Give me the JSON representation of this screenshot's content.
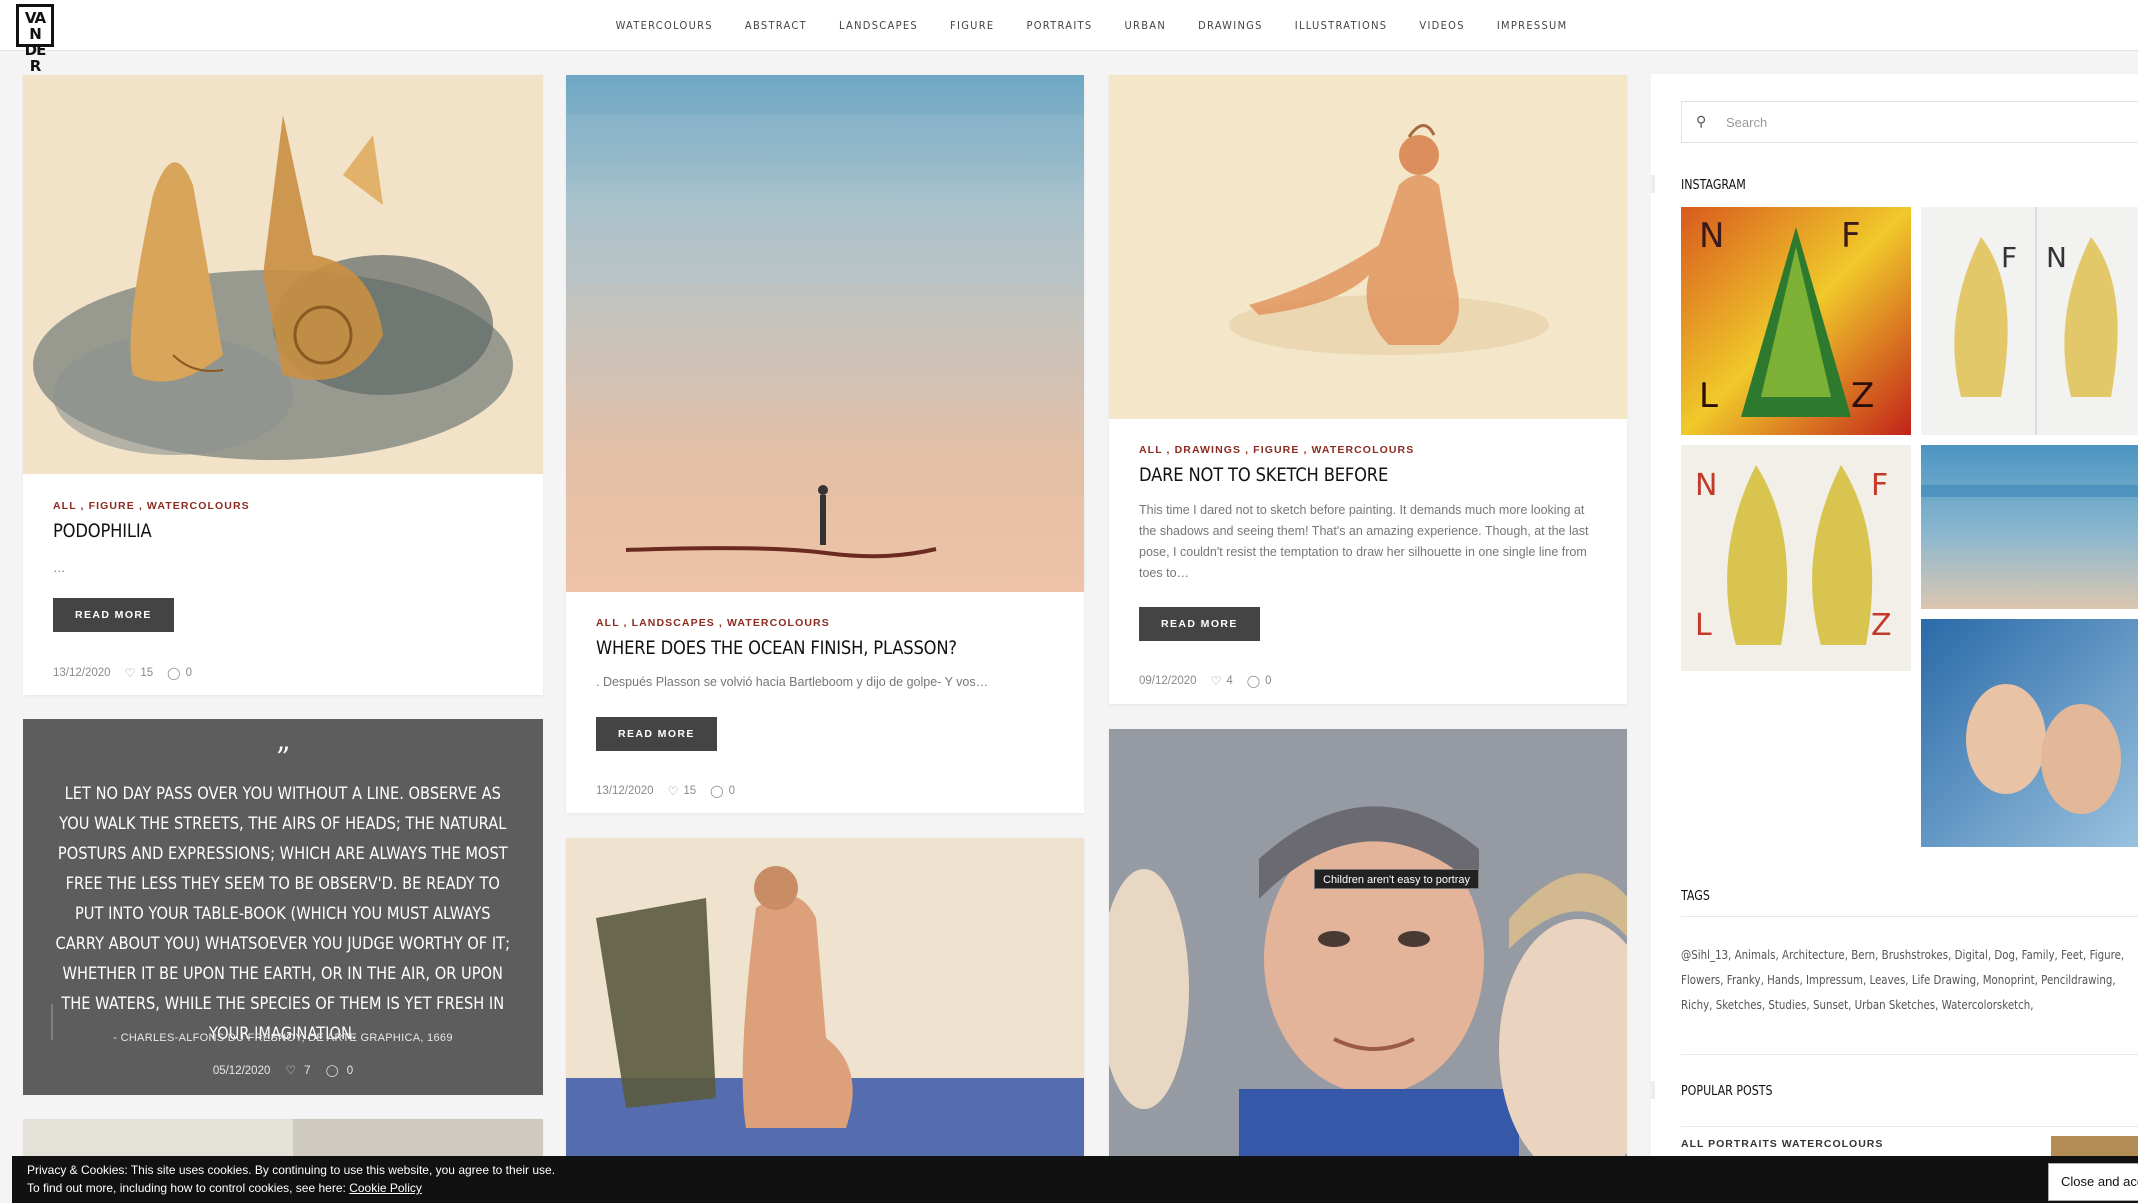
{
  "header": {
    "logo_text": "VAN DER",
    "nav": [
      "WATERCOLOURS",
      "ABSTRACT",
      "LANDSCAPES",
      "FIGURE",
      "PORTRAITS",
      "URBAN",
      "DRAWINGS",
      "ILLUSTRATIONS",
      "VIDEOS",
      "IMPRESSUM"
    ]
  },
  "posts": {
    "podophilia": {
      "cats": "ALL , FIGURE , WATERCOLOURS",
      "title": "PODOPHILIA",
      "excerpt": "…",
      "button": "READ MORE",
      "date": "13/12/2020",
      "likes": "15",
      "comments": "0"
    },
    "ocean": {
      "cats": "ALL , LANDSCAPES , WATERCOLOURS",
      "title": "WHERE DOES THE OCEAN FINISH, PLASSON?",
      "excerpt": ". Después Plasson se volvió hacia Bartleboom y dijo de golpe- Y vos…",
      "button": "READ MORE",
      "date": "13/12/2020",
      "likes": "15",
      "comments": "0"
    },
    "dare": {
      "cats": "ALL , DRAWINGS , FIGURE , WATERCOLOURS",
      "title": "DARE NOT TO SKETCH BEFORE",
      "excerpt": "This time I dared not to sketch before painting. It demands much more looking at the shadows and seeing them! That's an amazing experience. Though, at the last pose, I couldn't resist the temptation to draw her silhouette in one single line from toes to…",
      "button": "READ MORE",
      "date": "09/12/2020",
      "likes": "4",
      "comments": "0"
    }
  },
  "quote": {
    "mark": "”",
    "text": "Let no day pass over you without a line. Observe as you walk the streets, the airs of heads; the natural posturs and expressions; which are always the most free the less they seem to be observ'd. Be ready to put into your table-book (which you must always carry about you) whatsoever you judge worthy of it; whether it be upon the earth, or in the air, or upon the waters, while the species of them is yet fresh in your imagination.",
    "author": "- Charles-Alfons du Fresnoy, De Arte Graphica, 1669",
    "date": "05/12/2020",
    "likes": "7",
    "comments": "0"
  },
  "tooltip": "Children aren't easy to portray",
  "sidebar": {
    "search_placeholder": "Search",
    "instagram_title": "INSTAGRAM",
    "tags_title": "TAGS",
    "tags": [
      "@Sihl_13",
      "Animals",
      "Architecture",
      "Bern",
      "Brushstrokes",
      "Digital",
      "Dog",
      "Family",
      "Feet",
      "Figure",
      "Flowers",
      "Franky",
      "Hands",
      "Impressum",
      "Leaves",
      "Life Drawing",
      "Monoprint",
      "Pencildrawing",
      "Richy",
      "Sketches",
      "Studies",
      "Sunset",
      "Urban Sketches",
      "Watercolorsketch"
    ],
    "popular_title": "POPULAR POSTS",
    "popular_cat": "ALL PORTRAITS WATERCOLOURS"
  },
  "cookie": {
    "line1": "Privacy & Cookies: This site uses cookies. By continuing to use this website, you agree to their use.",
    "line2_prefix": "To find out more, including how to control cookies, see here: ",
    "link": "Cookie Policy",
    "close": "Close and accept"
  },
  "icons": {
    "heart": "heart-icon",
    "comment": "comment-icon",
    "search": "search-icon"
  },
  "colors": {
    "category": "#8b2b22",
    "button": "#444444",
    "quote_bg": "#5d5d5d",
    "cookie_bg": "#111111"
  }
}
